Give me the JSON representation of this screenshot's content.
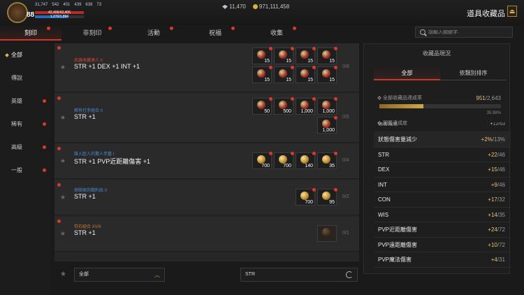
{
  "header": {
    "level": "88",
    "stats": [
      "31,747",
      "542",
      "401",
      "439",
      "638",
      "73"
    ],
    "hp_text": "42,406/42,406",
    "mp_text": "1,270/1,894",
    "hp_fraction": 1.0,
    "mp_fraction": 0.67,
    "gems": "11,470",
    "gold": "971,111,458",
    "title": "道具收藏品"
  },
  "tabs": [
    {
      "label": "刻印",
      "active": true
    },
    {
      "label": "非刻印",
      "active": false
    },
    {
      "label": "活動",
      "active": false
    },
    {
      "label": "祝福",
      "active": false
    },
    {
      "label": "收集",
      "active": false
    }
  ],
  "search": {
    "placeholder": "請輸入關鍵字."
  },
  "sidebar": [
    {
      "label": "全部",
      "active": true
    },
    {
      "label": "傳說",
      "active": false
    },
    {
      "label": "英雄",
      "active": false
    },
    {
      "label": "稀有",
      "active": false
    },
    {
      "label": "高級",
      "active": false
    },
    {
      "label": "一般",
      "active": false
    }
  ],
  "collections": [
    {
      "subtitle": "武器收藏達人 II",
      "subtitle_color": "#d04838",
      "stat": "STR +1 DEX +1 INT +1",
      "count": "0/8",
      "items": [
        {
          "qty": "15",
          "gem": "mix"
        },
        {
          "qty": "15",
          "gem": "mix"
        },
        {
          "qty": "15",
          "gem": "mix"
        },
        {
          "qty": "15",
          "gem": "mix"
        },
        {
          "qty": "15",
          "gem": "mix"
        },
        {
          "qty": "15",
          "gem": "mix"
        },
        {
          "qty": "15",
          "gem": "mix"
        },
        {
          "qty": "15",
          "gem": "mix"
        }
      ]
    },
    {
      "subtitle": "稀有打手組合 II",
      "subtitle_color": "#4a8ad0",
      "stat": "STR +1",
      "count": "0/5",
      "items": [
        {
          "qty": "50",
          "gem": "mix"
        },
        {
          "qty": "500",
          "gem": "mix"
        },
        {
          "qty": "1,000",
          "gem": "mix"
        },
        {
          "qty": "1,000",
          "gem": "mix"
        },
        {
          "qty": "1,000",
          "gem": "mix"
        }
      ]
    },
    {
      "subtitle": "誰入匠人的驚人手藝 I",
      "subtitle_color": "#4a8ad0",
      "stat": "STR +1 PVP近距離傷害 +1",
      "count": "0/4",
      "items": [
        {
          "qty": "700",
          "gem": "gold"
        },
        {
          "qty": "700",
          "gem": "gold"
        },
        {
          "qty": "140",
          "gem": "gold"
        },
        {
          "qty": "35",
          "gem": "gold"
        }
      ]
    },
    {
      "subtitle": "探險家的戰利品 II",
      "subtitle_color": "#4a8ad0",
      "stat": "STR +1",
      "count": "0/2",
      "items": [
        {
          "qty": "700",
          "gem": "gold"
        },
        {
          "qty": "95",
          "gem": "gold"
        }
      ]
    },
    {
      "subtitle": "符石組合 XVIII",
      "subtitle_color": "#c87830",
      "stat": "STR +1",
      "count": "0/1",
      "items": [
        {
          "qty": "",
          "gem": "dim"
        }
      ]
    }
  ],
  "filters": {
    "grade": "全部",
    "stat": "STR"
  },
  "panel": {
    "title": "收藏品現況",
    "tabs": [
      {
        "label": "全部",
        "active": true
      },
      {
        "label": "依類別排序",
        "active": false
      }
    ],
    "rate_label": "全部收藏品達成率",
    "rate_current": "951",
    "rate_total": "/2,643",
    "rate_fraction": 0.3598,
    "rate_percent": "35.98%",
    "section_label": "圖鑑達成度",
    "cut_row": {
      "label": "傷害減免",
      "current": "+",
      "max": "12/63"
    },
    "bonuses": [
      {
        "label": "狀態傷害量減少",
        "current": "+2%",
        "max": "/13%"
      },
      {
        "label": "STR",
        "current": "+22",
        "max": "/46"
      },
      {
        "label": "DEX",
        "current": "+15",
        "max": "/46"
      },
      {
        "label": "INT",
        "current": "+9",
        "max": "/46"
      },
      {
        "label": "CON",
        "current": "+17",
        "max": "/32"
      },
      {
        "label": "WIS",
        "current": "+14",
        "max": "/35"
      },
      {
        "label": "PVP近距離傷害",
        "current": "+24",
        "max": "/72"
      },
      {
        "label": "PVP遠距離傷害",
        "current": "+10",
        "max": "/72"
      },
      {
        "label": "PVP魔法傷害",
        "current": "+4",
        "max": "/31"
      }
    ]
  },
  "colors": {
    "accent": "#c8392b",
    "gold": "#d9b45a",
    "notify": "#d8392b"
  }
}
